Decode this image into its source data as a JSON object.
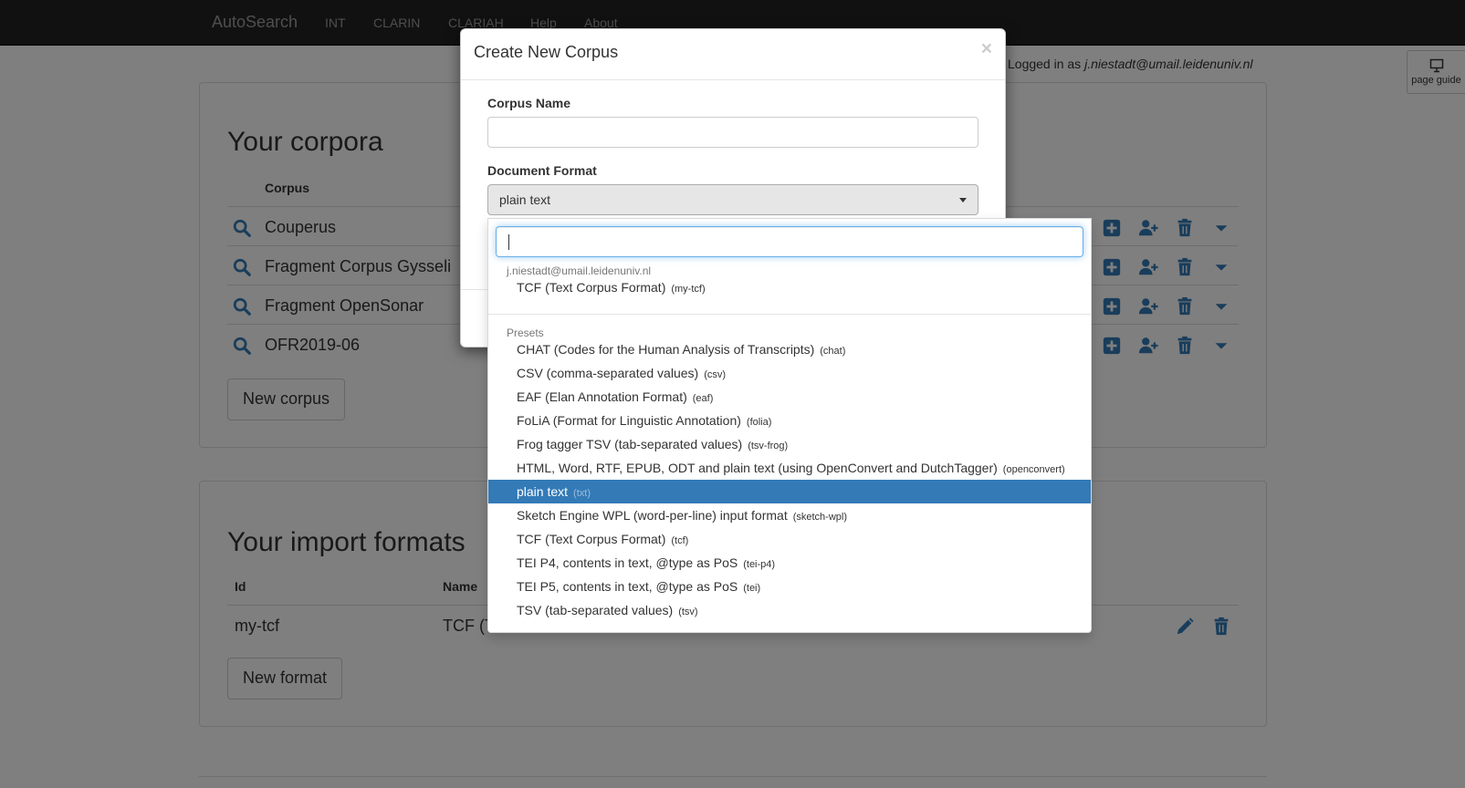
{
  "navbar": {
    "brand": "AutoSearch",
    "links": [
      "INT",
      "CLARIN",
      "CLARIAH",
      "Help",
      "About"
    ]
  },
  "user": {
    "prefix": "Logged in as ",
    "email": "j.niestadt@umail.leidenuniv.nl"
  },
  "page_guide": {
    "label": "page guide",
    "icon": "presentation-icon"
  },
  "corpora_panel": {
    "title": "Your corpora",
    "column_corpus": "Corpus",
    "rows": [
      {
        "name": "Couperus"
      },
      {
        "name": "Fragment Corpus Gysseli"
      },
      {
        "name": "Fragment OpenSonar"
      },
      {
        "name": "OFR2019-06"
      }
    ],
    "row_icons": [
      "search-icon",
      "plus-square-icon",
      "user-plus-icon",
      "trash-icon",
      "caret-down-icon"
    ],
    "new_button": "New corpus"
  },
  "formats_panel": {
    "title": "Your import formats",
    "column_id": "Id",
    "column_name": "Name",
    "rows": [
      {
        "id": "my-tcf",
        "name": "TCF (T"
      }
    ],
    "row_icons": [
      "pencil-icon",
      "trash-icon"
    ],
    "new_button": "New format"
  },
  "modal": {
    "title": "Create New Corpus",
    "close": "×",
    "corpus_name_label": "Corpus Name",
    "corpus_name_value": "",
    "document_format_label": "Document Format",
    "selected_format": "plain text"
  },
  "dropdown": {
    "search_value": "",
    "user_group": {
      "header": "j.niestadt@umail.leidenuniv.nl",
      "items": [
        {
          "label": "TCF (Text Corpus Format)",
          "id": "(my-tcf)"
        }
      ]
    },
    "preset_group": {
      "header": "Presets",
      "items": [
        {
          "label": "CHAT (Codes for the Human Analysis of Transcripts)",
          "id": "(chat)"
        },
        {
          "label": "CSV (comma-separated values)",
          "id": "(csv)"
        },
        {
          "label": "EAF (Elan Annotation Format)",
          "id": "(eaf)"
        },
        {
          "label": "FoLiA (Format for Linguistic Annotation)",
          "id": "(folia)"
        },
        {
          "label": "Frog tagger TSV (tab-separated values)",
          "id": "(tsv-frog)"
        },
        {
          "label": "HTML, Word, RTF, EPUB, ODT and plain text (using OpenConvert and DutchTagger)",
          "id": "(openconvert)"
        },
        {
          "label": "plain text",
          "id": "(txt)"
        },
        {
          "label": "Sketch Engine WPL (word-per-line) input format",
          "id": "(sketch-wpl)"
        },
        {
          "label": "TCF (Text Corpus Format)",
          "id": "(tcf)"
        },
        {
          "label": "TEI P4, contents in text, @type as PoS",
          "id": "(tei-p4)"
        },
        {
          "label": "TEI P5, contents in text, @type as PoS",
          "id": "(tei)"
        },
        {
          "label": "TSV (tab-separated values)",
          "id": "(tsv)"
        }
      ],
      "active_index": 6
    }
  },
  "colors": {
    "navbar": "#222222",
    "accent": "#337ab7",
    "icon": "#337ab7"
  }
}
